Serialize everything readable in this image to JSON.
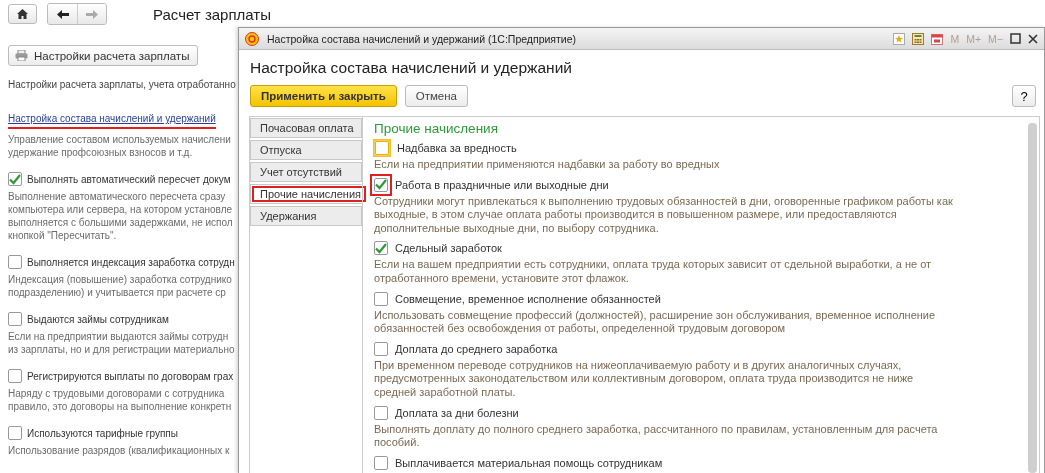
{
  "nav": {
    "back": {
      "disabled": false
    },
    "forward": {
      "disabled": true
    }
  },
  "page": {
    "title": "Расчет зарплаты",
    "settings_button": "Настройки расчета зарплаты",
    "intro": "Настройки расчета зарплаты, учета отработанно",
    "link": {
      "text": "Настройка состава начислений и удержаний",
      "highlighted": true
    },
    "link_description": [
      "Управление составом используемых начислени",
      "удержание профсоюзных взносов и т.д."
    ],
    "options": [
      {
        "label": "Выполнять автоматический пересчет докум",
        "checked": true,
        "description": [
          "Выполнение автоматического пересчета сразу",
          "компьютера или сервера, на котором установле",
          "выполняется с большими задержками, не испол",
          "кнопкой \"Пересчитать\"."
        ]
      },
      {
        "label": "Выполняется индексация заработка сотрудн",
        "checked": false,
        "description": [
          "Индексация (повышение) заработка сотруднико",
          "подразделению) и учитывается при расчете ср"
        ]
      },
      {
        "label": "Выдаются займы сотрудникам",
        "checked": false,
        "description": [
          "Если на предприятии выдаются займы сотрудн",
          "из зарплаты, но и для регистрации материально"
        ]
      },
      {
        "label": "Регистрируются выплаты по договорам грах",
        "checked": false,
        "description": [
          "Наряду с трудовыми договорами с сотрудника",
          "правило, это договоры на выполнение конкретн"
        ]
      },
      {
        "label": "Используются тарифные группы",
        "checked": false,
        "description": [
          "Использование разрядов (квалификационных к"
        ]
      }
    ]
  },
  "dialog": {
    "window_title": "Настройка состава начислений и удержаний  (1С:Предприятие)",
    "memory_buttons": [
      "M",
      "M+",
      "M−"
    ],
    "heading": "Настройка состава начислений и удержаний",
    "apply_button": "Применить и закрыть",
    "cancel_button": "Отмена",
    "help_button": "?",
    "tabs": [
      {
        "label": "Почасовая оплата",
        "selected": false,
        "highlighted": false
      },
      {
        "label": "Отпуска",
        "selected": false,
        "highlighted": false
      },
      {
        "label": "Учет отсутствий",
        "selected": false,
        "highlighted": false
      },
      {
        "label": "Прочие начисления",
        "selected": true,
        "highlighted": true
      },
      {
        "label": "Удержания",
        "selected": false,
        "highlighted": false
      }
    ],
    "section_title": "Прочие начисления",
    "items": [
      {
        "label": "Надбавка за вредность",
        "checked": false,
        "focused": true,
        "highlighted": false,
        "description": "Если на предприятии применяются надбавки за работу во вредных"
      },
      {
        "label": "Работа в праздничные или выходные дни",
        "checked": true,
        "focused": false,
        "highlighted": true,
        "description": "Сотрудники могут привлекаться к выполнению трудовых обязанностей в дни, оговоренные графиком работы как выходные, в этом случае оплата работы производится в повышенном размере, или предоставляются дополнительные выходные дни, по выбору сотрудника."
      },
      {
        "label": "Сдельный заработок",
        "checked": true,
        "focused": false,
        "highlighted": false,
        "description": "Если на вашем предприятии есть сотрудники, оплата труда которых зависит от сдельной выработки, а не от отработанного времени, установите этот флажок."
      },
      {
        "label": "Совмещение, временное исполнение обязанностей",
        "checked": false,
        "focused": false,
        "highlighted": false,
        "description": "Использовать совмещение профессий (должностей), расширение зон обслуживания, временное исполнение обязанностей без освобождения от работы, определенной трудовым договором"
      },
      {
        "label": "Доплата до среднего заработка",
        "checked": false,
        "focused": false,
        "highlighted": false,
        "description": "При временном переводе сотрудников на нижеоплачиваемую работу и в других аналогичных случаях, предусмотренных законодательством или коллективным договором, оплата труда производится не ниже средней заработной платы."
      },
      {
        "label": "Доплата за дни болезни",
        "checked": false,
        "focused": false,
        "highlighted": false,
        "description": "Выполнять доплату до полного среднего заработка, рассчитанного по правилам, установленным для расчета пособий."
      },
      {
        "label": "Выплачивается материальная помощь сотрудникам",
        "checked": false,
        "focused": false,
        "highlighted": false
      }
    ]
  }
}
